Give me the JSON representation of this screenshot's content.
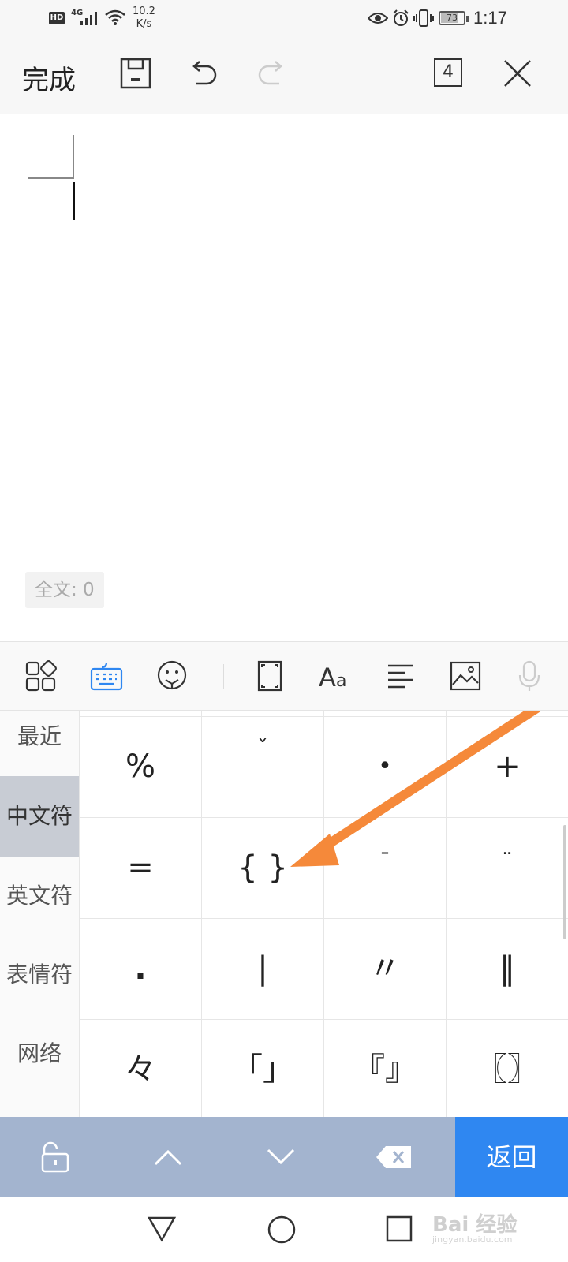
{
  "status_bar": {
    "hd_badge": "HD",
    "network_type": "4G",
    "net_speed_value": "10.2",
    "net_speed_unit": "K/s",
    "battery_level": "73",
    "time": "1:17",
    "icons": [
      "signal-icon",
      "wifi-icon",
      "eye-icon",
      "alarm-icon",
      "vibrate-icon",
      "battery-icon"
    ]
  },
  "toolbar": {
    "done_label": "完成",
    "tab_count": "4",
    "icons": [
      "save-icon",
      "undo-icon",
      "redo-icon",
      "tabs-icon",
      "close-icon"
    ]
  },
  "editor": {
    "word_count": "全文: 0"
  },
  "keyboard_toolbar": {
    "icons": [
      "apps-icon",
      "keyboard-icon",
      "emoji-icon",
      "fullscreen-icon",
      "font-icon",
      "align-icon",
      "image-icon",
      "microphone-icon"
    ]
  },
  "symbol_panel": {
    "categories": [
      {
        "label": "最近",
        "active": false
      },
      {
        "label": "中文符",
        "active": true
      },
      {
        "label": "英文符",
        "active": false
      },
      {
        "label": "表情符",
        "active": false
      },
      {
        "label": "网络",
        "active": false
      }
    ],
    "symbols": [
      "%",
      "ˇ",
      "•",
      "+",
      "=",
      "{ }",
      "ˉ",
      "¨",
      ".",
      "|",
      "〃",
      "‖",
      "々",
      "「」",
      "『』",
      "〖〗"
    ]
  },
  "action_bar": {
    "back_label": "返回",
    "icons": [
      "lock-icon",
      "chevron-up-icon",
      "chevron-down-icon",
      "backspace-icon"
    ]
  },
  "nav_bar": {
    "icons": [
      "back-triangle-icon",
      "home-circle-icon",
      "recents-square-icon"
    ]
  },
  "watermark": {
    "text": "Bai 经验",
    "subtext": "jingyan.baidu.com"
  },
  "annotation": {
    "arrow_color": "#f5893a"
  }
}
